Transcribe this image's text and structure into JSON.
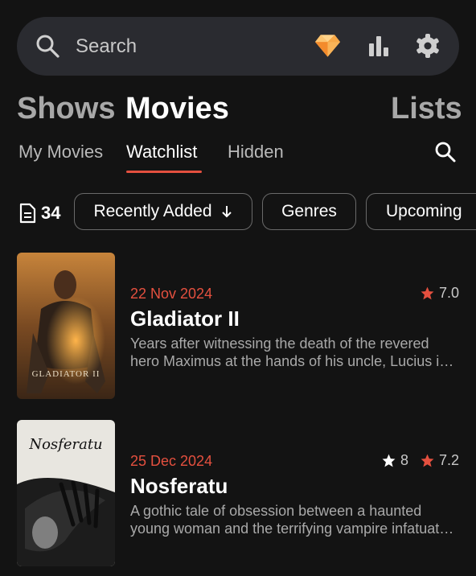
{
  "search": {
    "placeholder": "Search"
  },
  "toolbar_icons": [
    "premium-diamond-icon",
    "stats-icon",
    "settings-icon"
  ],
  "main_tabs": [
    {
      "label": "Shows",
      "active": false
    },
    {
      "label": "Movies",
      "active": true
    },
    {
      "label": "Lists",
      "active": false
    }
  ],
  "sub_tabs": [
    {
      "label": "My Movies",
      "active": false
    },
    {
      "label": "Watchlist",
      "active": true
    },
    {
      "label": "Hidden",
      "active": false
    }
  ],
  "filters": {
    "count": "34",
    "sort": "Recently Added",
    "genres": "Genres",
    "upcoming": "Upcoming"
  },
  "movies": [
    {
      "date": "22 Nov 2024",
      "title": "Gladiator II",
      "description_line1": "Years after witnessing the death of the revered",
      "description_line2": "hero Maximus at the hands of his uncle, Lucius i…",
      "rating": "7.0",
      "poster_text": "GLADIATOR II"
    },
    {
      "date": "25 Dec 2024",
      "title": "Nosferatu",
      "description_line1": "A gothic tale of obsession between a haunted",
      "description_line2": "young woman and the terrifying vampire infatuat…",
      "user_rating": "8",
      "rating": "7.2",
      "poster_text": "Nosferatu"
    }
  ],
  "colors": {
    "accent": "#e4503f",
    "background": "#131313",
    "surface": "#2a2b30"
  }
}
